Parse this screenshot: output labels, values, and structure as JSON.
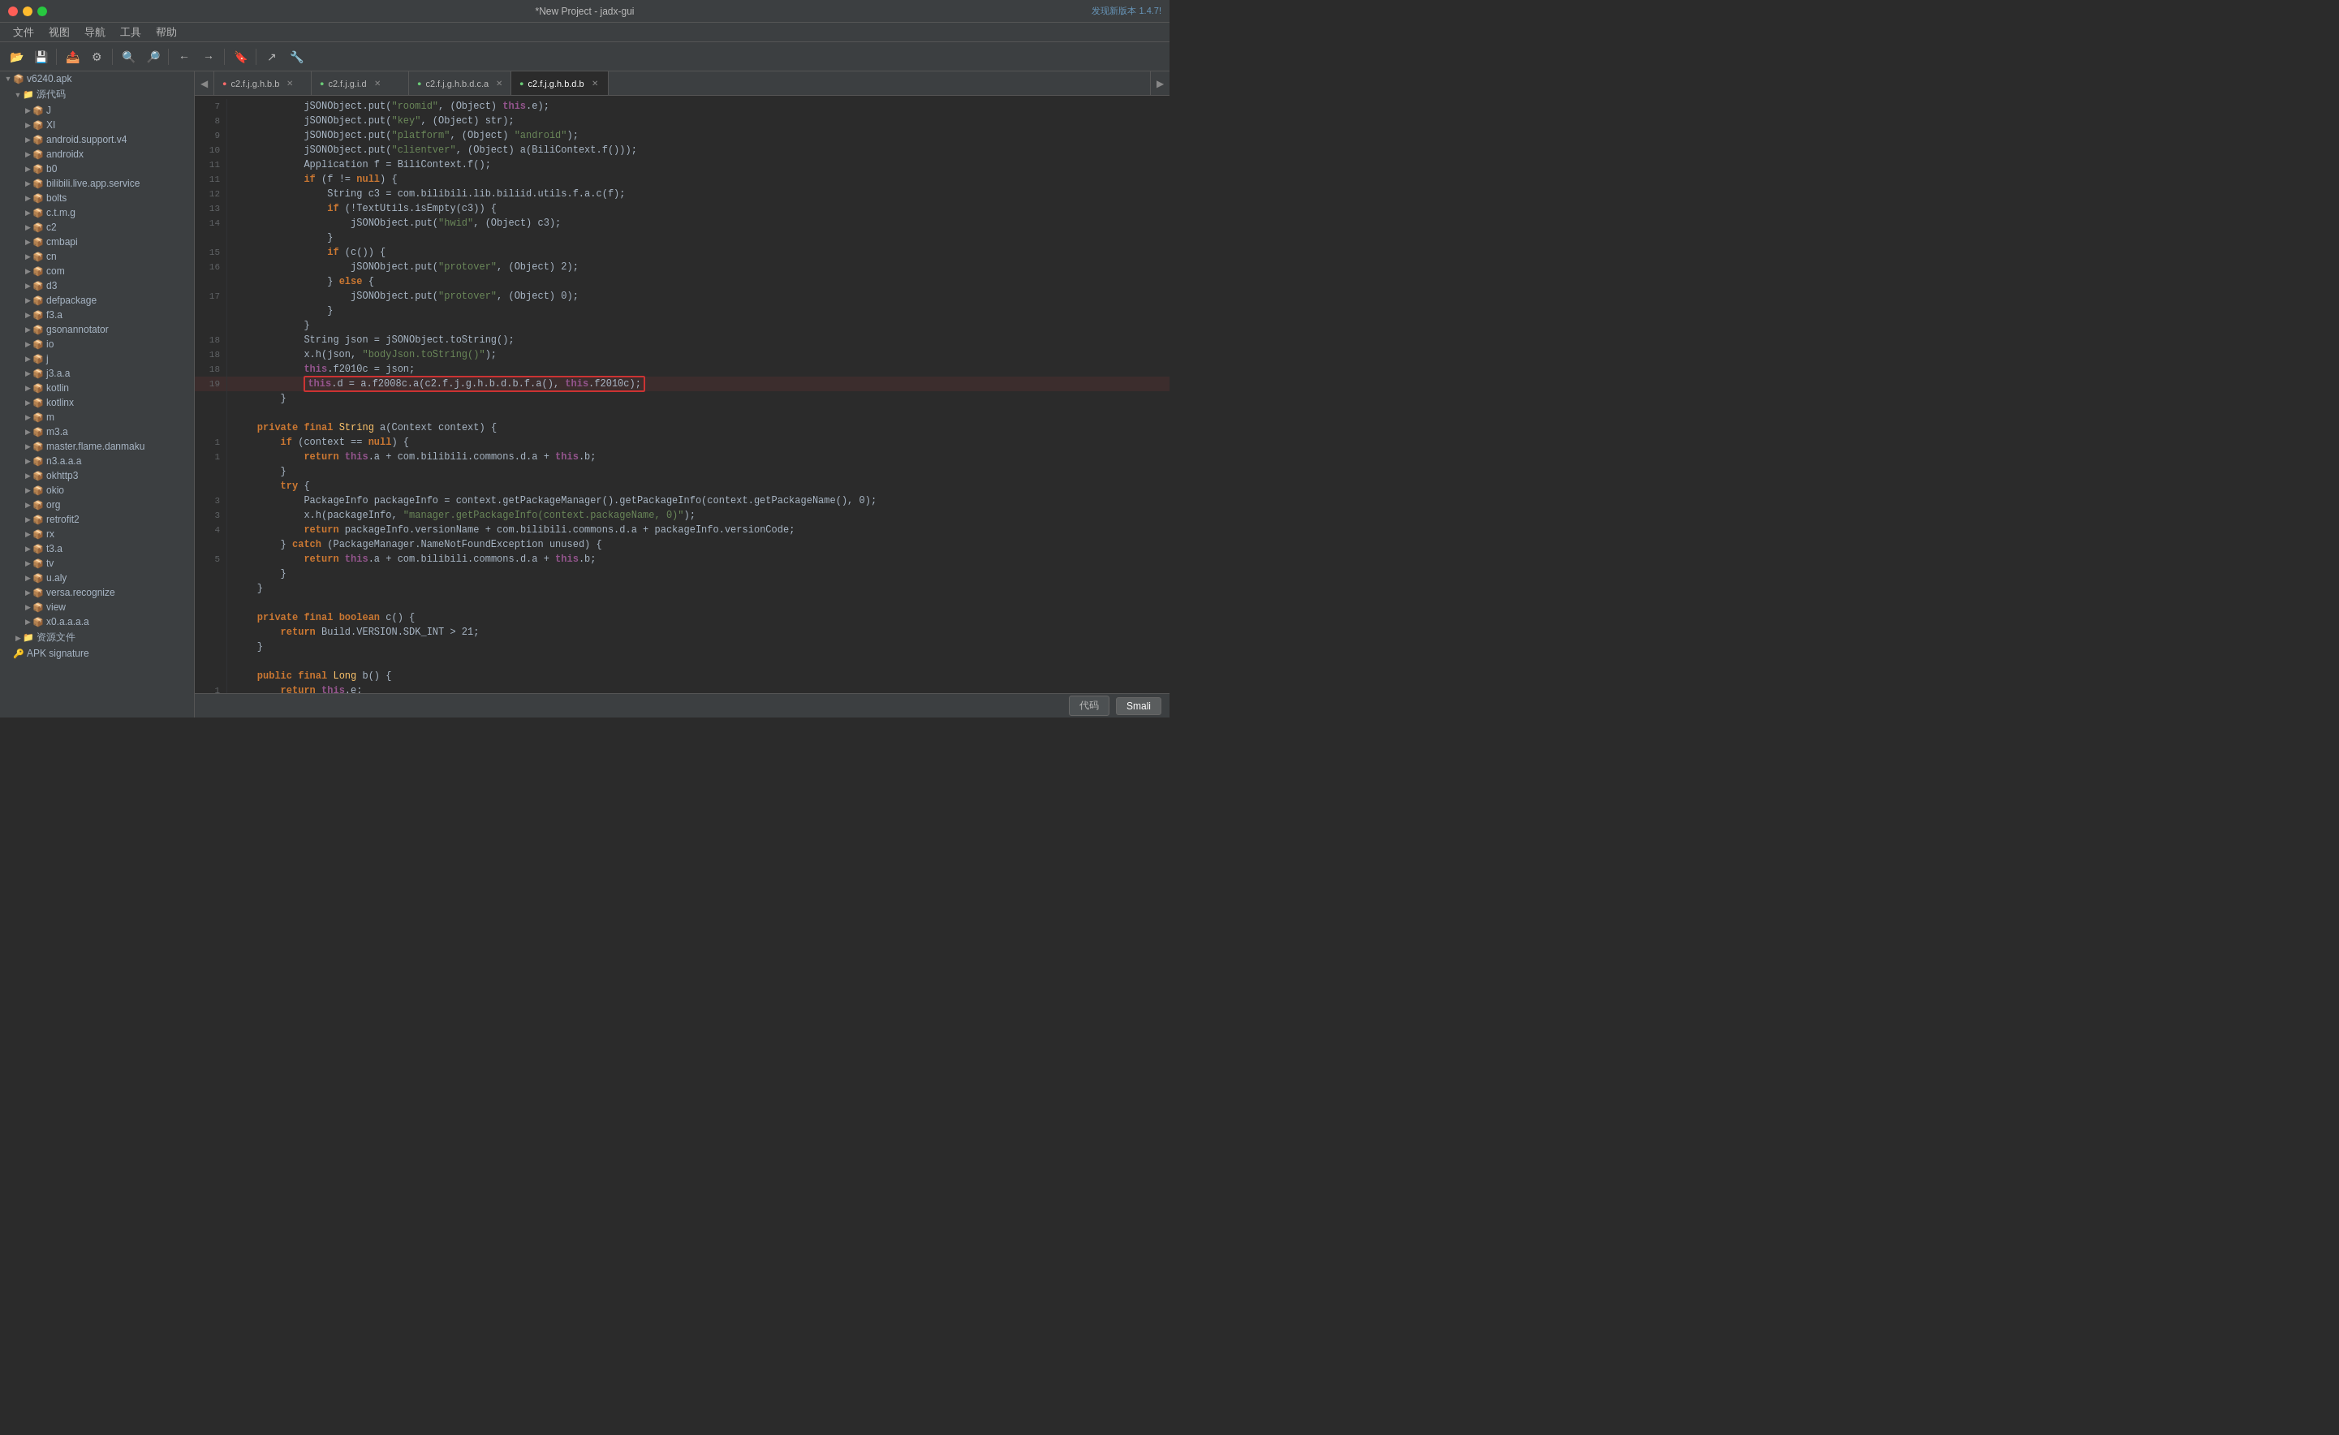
{
  "titlebar": {
    "title": "*New Project - jadx-gui",
    "update_notice": "发现新版本 1.4.7!"
  },
  "menubar": {
    "items": [
      "文件",
      "视图",
      "导航",
      "工具",
      "帮助"
    ]
  },
  "sidebar": {
    "root_label": "v6240.apk",
    "source_label": "源代码",
    "items": [
      {
        "label": "J",
        "depth": 2
      },
      {
        "label": "XI",
        "depth": 2
      },
      {
        "label": "android.support.v4",
        "depth": 2
      },
      {
        "label": "androidx",
        "depth": 2
      },
      {
        "label": "b0",
        "depth": 2
      },
      {
        "label": "bilibili.live.app.service",
        "depth": 2
      },
      {
        "label": "bolts",
        "depth": 2
      },
      {
        "label": "c.t.m.g",
        "depth": 2
      },
      {
        "label": "c2",
        "depth": 2
      },
      {
        "label": "cmbapi",
        "depth": 2
      },
      {
        "label": "cn",
        "depth": 2
      },
      {
        "label": "com",
        "depth": 2
      },
      {
        "label": "d3",
        "depth": 2
      },
      {
        "label": "defpackage",
        "depth": 2
      },
      {
        "label": "f3.a",
        "depth": 2
      },
      {
        "label": "gsonannotator",
        "depth": 2
      },
      {
        "label": "io",
        "depth": 2
      },
      {
        "label": "j",
        "depth": 2
      },
      {
        "label": "j3.a.a",
        "depth": 2
      },
      {
        "label": "kotlin",
        "depth": 2
      },
      {
        "label": "kotlinx",
        "depth": 2
      },
      {
        "label": "m",
        "depth": 2
      },
      {
        "label": "m3.a",
        "depth": 2
      },
      {
        "label": "master.flame.danmaku",
        "depth": 2
      },
      {
        "label": "n3.a.a.a",
        "depth": 2
      },
      {
        "label": "okhttp3",
        "depth": 2
      },
      {
        "label": "okio",
        "depth": 2
      },
      {
        "label": "org",
        "depth": 2
      },
      {
        "label": "retrofit2",
        "depth": 2
      },
      {
        "label": "rx",
        "depth": 2
      },
      {
        "label": "t3.a",
        "depth": 2
      },
      {
        "label": "tv",
        "depth": 2
      },
      {
        "label": "u.aly",
        "depth": 2
      },
      {
        "label": "versa.recognize",
        "depth": 2
      },
      {
        "label": "view",
        "depth": 2
      },
      {
        "label": "x0.a.a.a.a",
        "depth": 2
      }
    ],
    "resources_label": "资源文件",
    "apk_label": "APK signature"
  },
  "tabs": [
    {
      "label": "c2.f.j.g.h.b.b",
      "active": false,
      "dot_color": "#ff6b6b"
    },
    {
      "label": "c2.f.j.g.i.d",
      "active": false,
      "dot_color": "#6bcb77"
    },
    {
      "label": "c2.f.j.g.h.b.d.c.a",
      "active": false,
      "dot_color": "#6bcb77"
    },
    {
      "label": "c2.f.j.g.h.b.d.b",
      "active": true,
      "dot_color": "#6bcb77"
    }
  ],
  "bottombar": {
    "btn1": "代码",
    "btn2": "Smali"
  },
  "code": {
    "lines": []
  }
}
